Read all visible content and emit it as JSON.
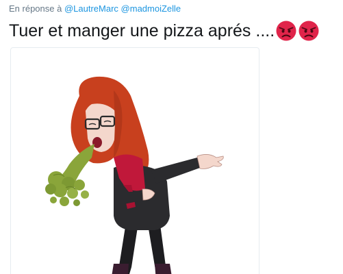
{
  "reply": {
    "prefix": "En réponse à",
    "mentions": [
      "@LautreMarc",
      "@madmoiZelle"
    ]
  },
  "tweet": {
    "text": "Tuer et manger une pizza aprés ....",
    "emojis": [
      "pouting-face-emoji",
      "pouting-face-emoji"
    ]
  },
  "media": {
    "type": "image",
    "subject": "bitmoji-avatar-vomiting-icon"
  },
  "colors": {
    "link": "#1b95e0",
    "muted": "#657786",
    "text": "#14171a",
    "hair": "#c8401e",
    "scarf": "#c0183a",
    "vomit": "#8aa53a",
    "jacket": "#2b2b2e"
  }
}
